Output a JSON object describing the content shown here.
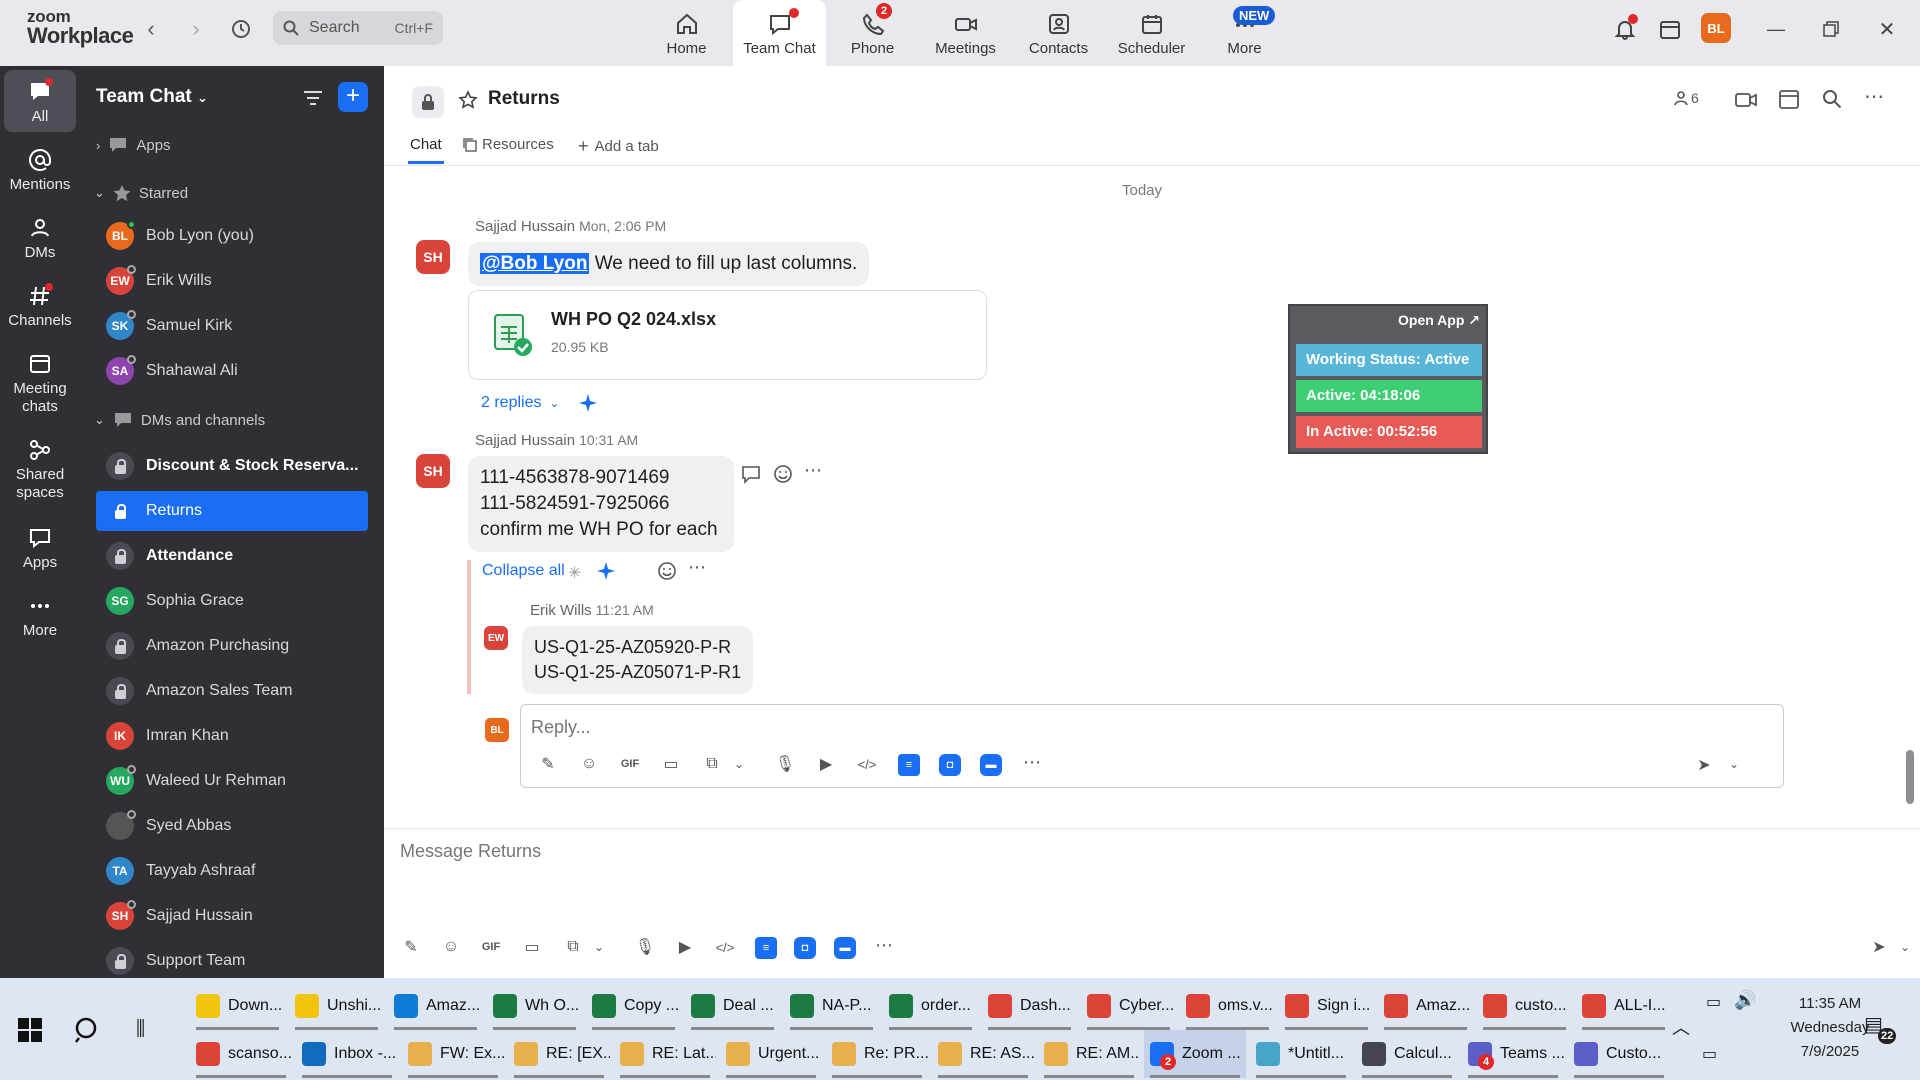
{
  "app": {
    "logo_line1": "zoom",
    "logo_line2": "Workplace"
  },
  "topbar": {
    "search_label": "Search",
    "search_shortcut": "Ctrl+F",
    "tabs": [
      {
        "label": "Home",
        "icon": "home-icon"
      },
      {
        "label": "Team Chat",
        "icon": "chat-icon"
      },
      {
        "label": "Phone",
        "icon": "phone-icon",
        "badge": "2"
      },
      {
        "label": "Meetings",
        "icon": "video-icon"
      },
      {
        "label": "Contacts",
        "icon": "contacts-icon"
      },
      {
        "label": "Scheduler",
        "icon": "calendar-icon"
      },
      {
        "label": "More",
        "icon": "more-icon"
      }
    ],
    "new_badge": "NEW",
    "user_initials": "BL"
  },
  "rail": [
    {
      "label": "All",
      "icon": "chat-icon"
    },
    {
      "label": "Mentions",
      "icon": "at-icon"
    },
    {
      "label": "DMs",
      "icon": "people-icon"
    },
    {
      "label": "Channels",
      "icon": "hash-icon"
    },
    {
      "label": "Meeting chats",
      "icon": "calendar-icon"
    },
    {
      "label": "Shared spaces",
      "icon": "share-icon"
    },
    {
      "label": "Apps",
      "icon": "apps-icon"
    },
    {
      "label": "More",
      "icon": "dots-icon"
    }
  ],
  "sidebar": {
    "title": "Team Chat",
    "apps_label": "Apps",
    "starred_label": "Starred",
    "dms_label": "DMs and channels",
    "starred": [
      {
        "name": "Bob Lyon (you)",
        "initials": "BL",
        "color": "#e86a1c",
        "status": "on"
      },
      {
        "name": "Erik Wills",
        "initials": "EW",
        "color": "#d9443a",
        "status": "off"
      },
      {
        "name": "Samuel Kirk",
        "initials": "SK",
        "color": "#2f86c8",
        "status": "off"
      },
      {
        "name": "Shahawal Ali",
        "initials": "SA",
        "color": "#8e44ad",
        "status": "off"
      }
    ],
    "items": [
      {
        "name": "Discount & Stock Reserva...",
        "type": "channel",
        "bold": true
      },
      {
        "name": "Returns",
        "type": "channel",
        "active": true
      },
      {
        "name": "Attendance",
        "type": "channel",
        "bold": true
      },
      {
        "name": "Sophia Grace",
        "initials": "SG",
        "color": "#27a861",
        "type": "dm"
      },
      {
        "name": "Amazon Purchasing",
        "type": "channel"
      },
      {
        "name": "Amazon Sales Team",
        "type": "channel"
      },
      {
        "name": "Imran Khan",
        "initials": "IK",
        "color": "#d9443a",
        "type": "dm"
      },
      {
        "name": "Waleed Ur Rehman",
        "initials": "WU",
        "color": "#27a861",
        "type": "dm"
      },
      {
        "name": "Syed Abbas",
        "initials": "",
        "color": "#555",
        "type": "dm"
      },
      {
        "name": "Tayyab Ashraaf",
        "initials": "TA",
        "color": "#2f86c8",
        "type": "dm"
      },
      {
        "name": "Sajjad Hussain",
        "initials": "SH",
        "color": "#d9443a",
        "type": "dm"
      },
      {
        "name": "Support Team",
        "type": "channel"
      }
    ]
  },
  "channel": {
    "title": "Returns",
    "member_count": "6",
    "tabs": [
      "Chat",
      "Resources",
      "Add a tab"
    ],
    "date_divider": "Today"
  },
  "messages": [
    {
      "author": "Sajjad Hussain",
      "time": "Mon, 2:06 PM",
      "initials": "SH",
      "mention": "@Bob Lyon",
      "text": " We need to fill up last columns.",
      "file": {
        "name": "WH PO Q2 024.xlsx",
        "size": "20.95 KB"
      },
      "replies": "2 replies"
    },
    {
      "author": "Sajjad Hussain",
      "time": "10:31 AM",
      "initials": "SH",
      "lines": [
        "111-4563878-9071469",
        "111-5824591-7925066",
        "confirm me WH PO for each"
      ],
      "collapse": "Collapse all",
      "reply": {
        "author": "Erik Wills",
        "time": "11:21 AM",
        "initials": "EW",
        "lines": [
          "US-Q1-25-AZ05920-P-R",
          "US-Q1-25-AZ05071-P-R1"
        ]
      }
    }
  ],
  "reply_box": {
    "placeholder": "Reply...",
    "user_initials": "BL"
  },
  "composer": {
    "placeholder": "Message Returns"
  },
  "status_panel": {
    "open_app": "Open App ↗",
    "working": "Working Status: Active",
    "active": "Active: 04:18:06",
    "inactive": "In Active: 00:52:56"
  },
  "taskbar": {
    "row1": [
      {
        "label": "Down...",
        "color": "#f2c40d"
      },
      {
        "label": "Unshi...",
        "color": "#f2c40d"
      },
      {
        "label": "Amaz...",
        "color": "#0f7bd6"
      },
      {
        "label": "Wh O...",
        "color": "#1d7a43"
      },
      {
        "label": "Copy ...",
        "color": "#1d7a43"
      },
      {
        "label": "Deal ...",
        "color": "#1d7a43"
      },
      {
        "label": "NA-P...",
        "color": "#1d7a43"
      },
      {
        "label": "order...",
        "color": "#1d7a43"
      },
      {
        "label": "Dash...",
        "color": "#db4437"
      },
      {
        "label": "Cyber...",
        "color": "#db4437"
      },
      {
        "label": "oms.v...",
        "color": "#db4437"
      },
      {
        "label": "Sign i...",
        "color": "#db4437"
      },
      {
        "label": "Amaz...",
        "color": "#db4437"
      },
      {
        "label": "custo...",
        "color": "#db4437"
      },
      {
        "label": "ALL-I...",
        "color": "#db4437"
      }
    ],
    "row2": [
      {
        "label": "scanso...",
        "color": "#db4437"
      },
      {
        "label": "Inbox -...",
        "color": "#0f6cbd"
      },
      {
        "label": "FW: Ex...",
        "color": "#e8b04c"
      },
      {
        "label": "RE: [EX...",
        "color": "#e8b04c"
      },
      {
        "label": "RE: Lat...",
        "color": "#e8b04c"
      },
      {
        "label": "Urgent...",
        "color": "#e8b04c"
      },
      {
        "label": "Re: PR...",
        "color": "#e8b04c"
      },
      {
        "label": "RE: AS...",
        "color": "#e8b04c"
      },
      {
        "label": "RE: AM...",
        "color": "#e8b04c"
      },
      {
        "label": "Zoom ...",
        "color": "#1a6ef4",
        "badge": "2"
      },
      {
        "label": "*Untitl...",
        "color": "#48a4c8"
      },
      {
        "label": "Calcul...",
        "color": "#445"
      },
      {
        "label": "Teams ...",
        "color": "#5b5fc7",
        "badge": "4"
      },
      {
        "label": "Custo...",
        "color": "#5b5fc7"
      }
    ],
    "time": "11:35 AM",
    "day": "Wednesday",
    "date": "7/9/2025",
    "notif": "22"
  }
}
